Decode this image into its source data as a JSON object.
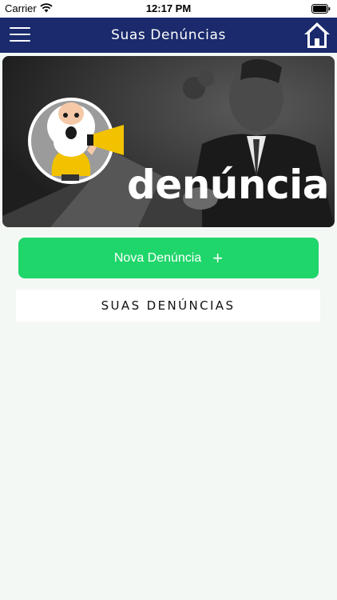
{
  "status_bar": {
    "carrier": "Carrier",
    "time": "12:17 PM"
  },
  "navbar": {
    "title": "Suas  Denúncias",
    "menu_icon": "hamburger-menu-icon",
    "home_icon": "home-icon"
  },
  "banner": {
    "word": "denúncia",
    "mascot": "old-man-megaphone"
  },
  "actions": {
    "new_report_label": "Nova Denúncia",
    "new_report_icon": "+"
  },
  "section": {
    "title": "SUAS DENÚNCIAS"
  },
  "colors": {
    "navbar": "#1a2a6c",
    "accent_green": "#1fd66a",
    "background": "#f4f8f5",
    "megaphone": "#f2c200"
  }
}
